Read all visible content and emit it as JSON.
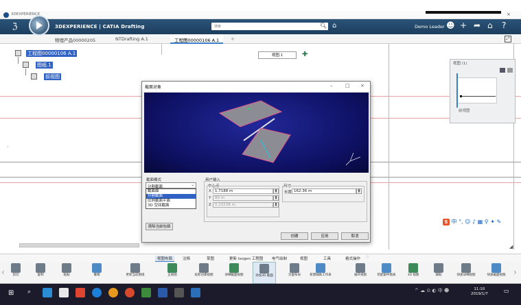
{
  "window": {
    "title": "3DEXPERIENCE"
  },
  "header": {
    "brand": "3DEXPERIENCE | CATIA Drafting",
    "search_placeholder": "搜索",
    "user": "Demo Leader"
  },
  "tabs": [
    {
      "label": "物理产品00000205"
    },
    {
      "label": "NTDrafting A.1"
    },
    {
      "label": "工程图00000106 A.1"
    }
  ],
  "tree": {
    "root": "工程图00000106 A.1",
    "sheet": "图纸.1",
    "view": "前视图"
  },
  "view_name_field": "视图.1",
  "right_panel": {
    "title": "视图 (1)",
    "view_label": "前视图"
  },
  "dialog": {
    "title": "截面对象",
    "section_mode_label": "截面模式",
    "section_mode_value": "分割截面",
    "section_mode_options": [
      "截面面",
      "分割截面",
      "比例截面平面",
      "3D 空间截面"
    ],
    "section_mode_selected_index": 1,
    "user_input_label": "用户输入",
    "center_label": "中心点",
    "x_label": "X",
    "x_value": "1.7188 m",
    "y_label": "Y",
    "y_value": "80 m",
    "z_label": "Z",
    "z_value": "0.23238 m",
    "size_label": "尺寸",
    "length_label": "长度",
    "length_value": "162.36 m",
    "clear_button": "清除当前包络",
    "buttons": {
      "create": "创建",
      "apply": "应用",
      "cancel": "取消"
    }
  },
  "section_tabs": [
    "视图布局",
    "注释",
    "草图",
    "更新 Isogen 工程图",
    "电气绘制",
    "视图",
    "工具",
    "格式操作"
  ],
  "actions": [
    {
      "label": "剪切",
      "icon": "scissors-icon"
    },
    {
      "label": "复制",
      "icon": "copy-icon"
    },
    {
      "label": "粘贴",
      "icon": "paste-icon"
    },
    {
      "label": "撤销",
      "icon": "undo-icon"
    },
    {
      "label": "更新当前图纸",
      "icon": "update-icon"
    },
    {
      "label": "正视图",
      "icon": "front-view-icon"
    },
    {
      "label": "投影创建视图",
      "icon": "projection-icon"
    },
    {
      "label": "详细截面视图",
      "icon": "detail-section-icon"
    },
    {
      "label": "添加3D 截面",
      "icon": "3d-section-icon"
    },
    {
      "label": "页面布局",
      "icon": "page-layout-icon"
    },
    {
      "label": "新建辅助工作表",
      "icon": "new-sheet-icon"
    },
    {
      "label": "展开视图",
      "icon": "unfold-view-icon"
    },
    {
      "label": "装配部件图表",
      "icon": "assembly-icon"
    },
    {
      "label": "3D 视图",
      "icon": "3d-view-icon"
    },
    {
      "label": "辅助",
      "icon": "aux-icon"
    },
    {
      "label": "快速详细视图",
      "icon": "quick-detail-icon"
    },
    {
      "label": "快速截面视图",
      "icon": "quick-section-icon"
    }
  ],
  "taskbar": {
    "time": "11:10",
    "date": "2019/1/7"
  },
  "colors": {
    "accent": "#3a7fc4",
    "toolbar": "#1d3e5e",
    "selection": "#2f62c4"
  }
}
